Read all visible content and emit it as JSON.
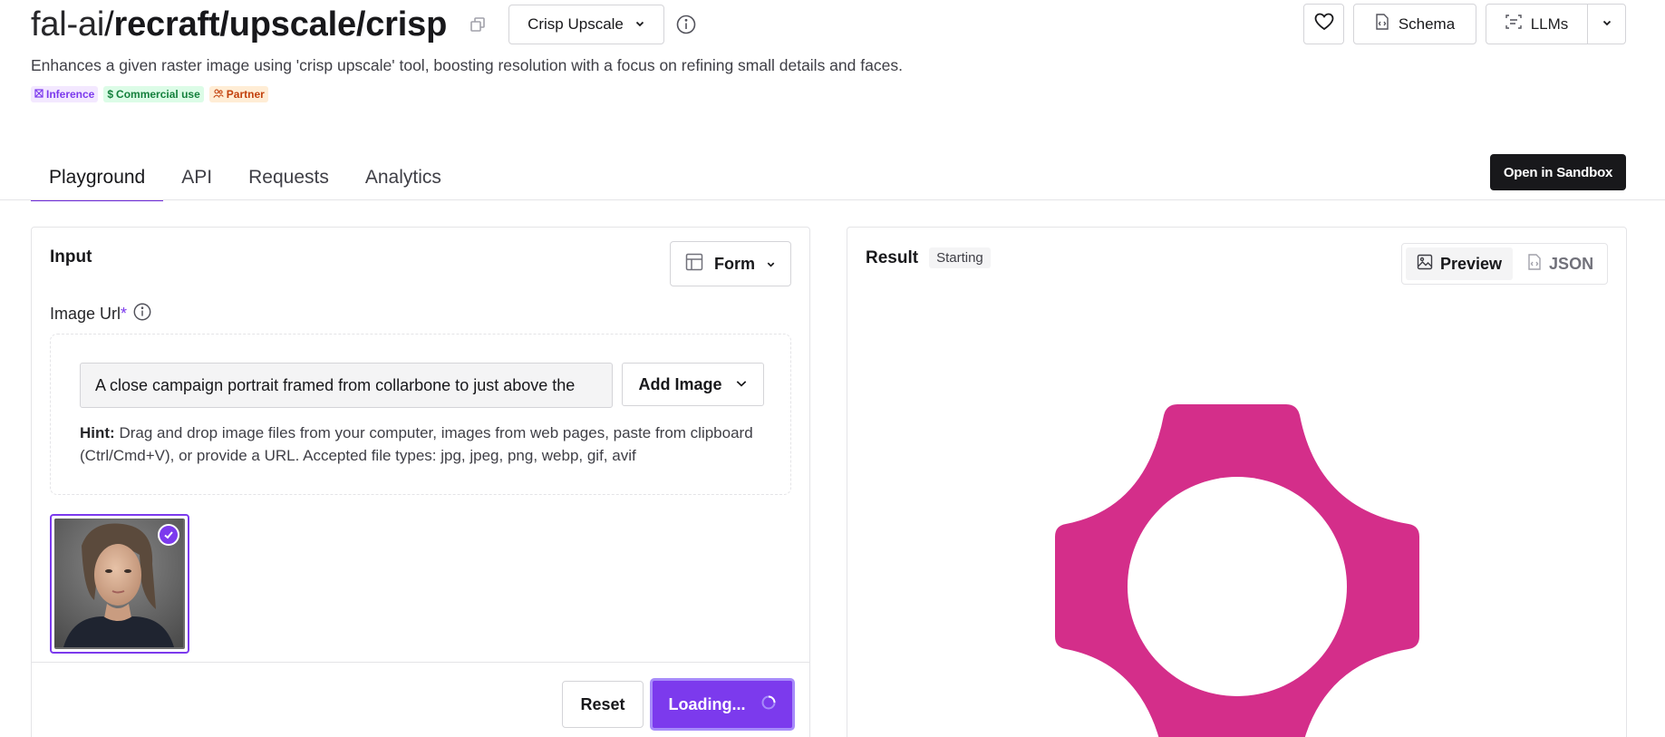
{
  "header": {
    "namespace": "fal-ai",
    "separator": "/",
    "model_path": "recraft/upscale/crisp",
    "variant_label": "Crisp Upscale",
    "description": "Enhances a given raster image using 'crisp upscale' tool, boosting resolution with a focus on refining small details and faces.",
    "badges": [
      {
        "label": "Inference",
        "icon": "inference-icon"
      },
      {
        "label": "Commercial use",
        "icon": "dollar-icon"
      },
      {
        "label": "Partner",
        "icon": "partner-icon"
      }
    ]
  },
  "top_actions": {
    "schema_label": "Schema",
    "llms_label": "LLMs"
  },
  "tabs": [
    {
      "label": "Playground",
      "active": true
    },
    {
      "label": "API",
      "active": false
    },
    {
      "label": "Requests",
      "active": false
    },
    {
      "label": "Analytics",
      "active": false
    }
  ],
  "sandbox_label": "Open in Sandbox",
  "input_panel": {
    "title": "Input",
    "form_label": "Form",
    "field_label": "Image Url",
    "required_mark": "*",
    "url_value": "A close campaign portrait framed from collarbone to just above the",
    "add_image_label": "Add Image",
    "hint_bold": "Hint:",
    "hint_text": " Drag and drop image files from your computer, images from web pages, paste from clipboard (Ctrl/Cmd+V), or provide a URL. Accepted file types: jpg, jpeg, png, webp, gif, avif",
    "reset_label": "Reset",
    "loading_label": "Loading..."
  },
  "result_panel": {
    "title": "Result",
    "status": "Starting",
    "preview_label": "Preview",
    "json_label": "JSON"
  },
  "colors": {
    "accent": "#7c3aed",
    "logo": "#d42e8a",
    "dark": "#18181b"
  }
}
